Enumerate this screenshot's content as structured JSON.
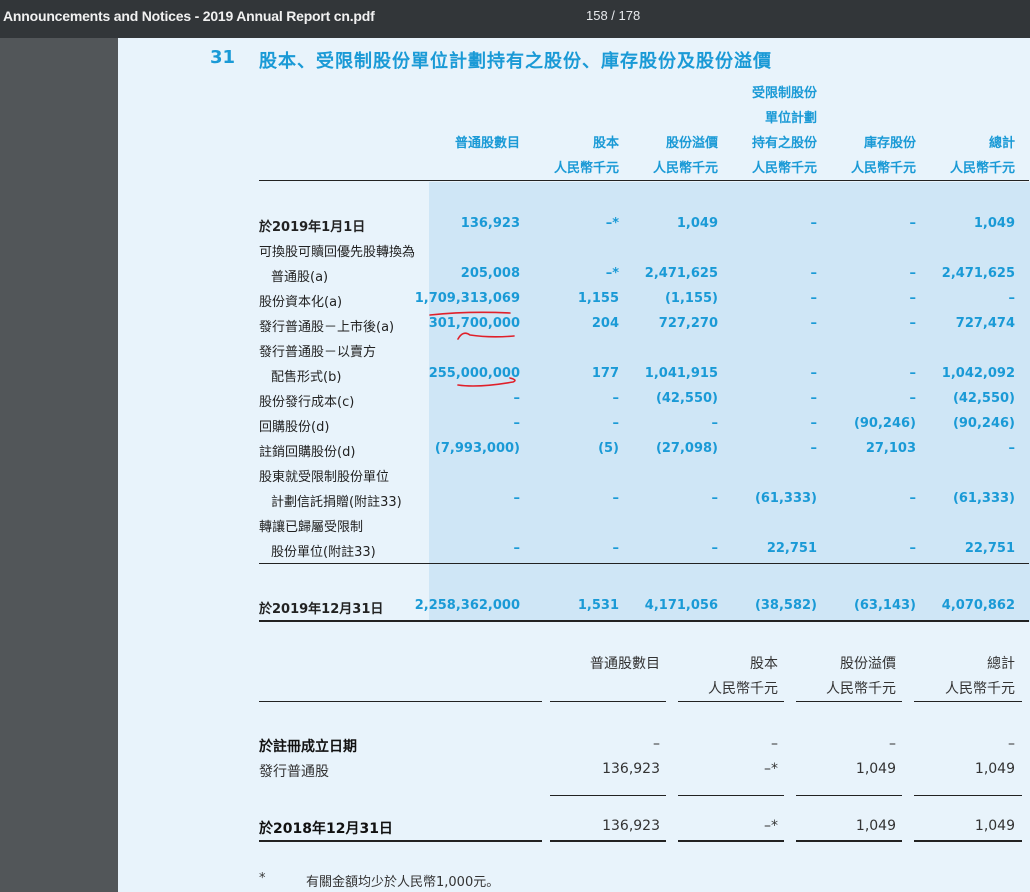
{
  "viewer": {
    "doc_title": "Announcements and Notices - 2019 Annual Report cn.pdf",
    "page_counter": "158 / 178"
  },
  "section": {
    "number": "31",
    "title": "股本、受限制股份單位計劃持有之股份、庫存股份及股份溢價"
  },
  "table1": {
    "headers": [
      {
        "lines": [
          "普通股數目"
        ]
      },
      {
        "lines": [
          "股本",
          "人民幣千元"
        ]
      },
      {
        "lines": [
          "股份溢價",
          "人民幣千元"
        ]
      },
      {
        "lines": [
          "受限制股份",
          "單位計劃",
          "持有之股份",
          "人民幣千元"
        ]
      },
      {
        "lines": [
          "庫存股份",
          "人民幣千元"
        ]
      },
      {
        "lines": [
          "總計",
          "人民幣千元"
        ]
      }
    ],
    "rows": [
      {
        "label": "於2019年1月1日",
        "bold": true,
        "values": [
          "136,923",
          "–*",
          "1,049",
          "–",
          "–",
          "1,049"
        ]
      },
      {
        "label": "可換股可贖回優先股轉換為",
        "values": []
      },
      {
        "label": "普通股(a)",
        "indent": true,
        "values": [
          "205,008",
          "–*",
          "2,471,625",
          "–",
          "–",
          "2,471,625"
        ]
      },
      {
        "label": "股份資本化(a)",
        "values": [
          "1,709,313,069",
          "1,155",
          "(1,155)",
          "–",
          "–",
          "–"
        ]
      },
      {
        "label": "發行普通股－上市後(a)",
        "values": [
          "301,700,000",
          "204",
          "727,270",
          "–",
          "–",
          "727,474"
        ]
      },
      {
        "label": "發行普通股－以賣方",
        "values": []
      },
      {
        "label": "配售形式(b)",
        "indent": true,
        "values": [
          "255,000,000",
          "177",
          "1,041,915",
          "–",
          "–",
          "1,042,092"
        ]
      },
      {
        "label": "股份發行成本(c)",
        "values": [
          "–",
          "–",
          "(42,550)",
          "–",
          "–",
          "(42,550)"
        ]
      },
      {
        "label": "回購股份(d)",
        "values": [
          "–",
          "–",
          "–",
          "–",
          "(90,246)",
          "(90,246)"
        ]
      },
      {
        "label": "註銷回購股份(d)",
        "values": [
          "(7,993,000)",
          "(5)",
          "(27,098)",
          "–",
          "27,103",
          "–"
        ]
      },
      {
        "label": "股東就受限制股份單位",
        "values": []
      },
      {
        "label": "計劃信託捐贈(附註33)",
        "indent": true,
        "values": [
          "–",
          "–",
          "–",
          "(61,333)",
          "–",
          "(61,333)"
        ]
      },
      {
        "label": "轉讓已歸屬受限制",
        "values": []
      },
      {
        "label": "股份單位(附註33)",
        "indent": true,
        "values": [
          "–",
          "–",
          "–",
          "22,751",
          "–",
          "22,751"
        ]
      }
    ],
    "total": {
      "label": "於2019年12月31日",
      "values": [
        "2,258,362,000",
        "1,531",
        "4,171,056",
        "(38,582)",
        "(63,143)",
        "4,070,862"
      ]
    }
  },
  "table2": {
    "headers": [
      {
        "lines": [
          "普通股數目"
        ]
      },
      {
        "lines": [
          "股本",
          "人民幣千元"
        ]
      },
      {
        "lines": [
          "股份溢價",
          "人民幣千元"
        ]
      },
      {
        "lines": [
          "總計",
          "人民幣千元"
        ]
      }
    ],
    "rows": [
      {
        "label": "於註冊成立日期",
        "bold": true,
        "values": [
          "–",
          "–",
          "–",
          "–"
        ]
      },
      {
        "label": "發行普通股",
        "values": [
          "136,923",
          "–*",
          "1,049",
          "1,049"
        ]
      }
    ],
    "total": {
      "label": "於2018年12月31日",
      "values": [
        "136,923",
        "–*",
        "1,049",
        "1,049"
      ]
    }
  },
  "footnote": {
    "mark": "*",
    "text": "有關金額均少於人民幣1,000元。"
  },
  "colors": {
    "accent": "#1a9ad6",
    "shade": "#cfe6f6",
    "page": "#e8f3fb",
    "annotation": "#e0202a"
  }
}
